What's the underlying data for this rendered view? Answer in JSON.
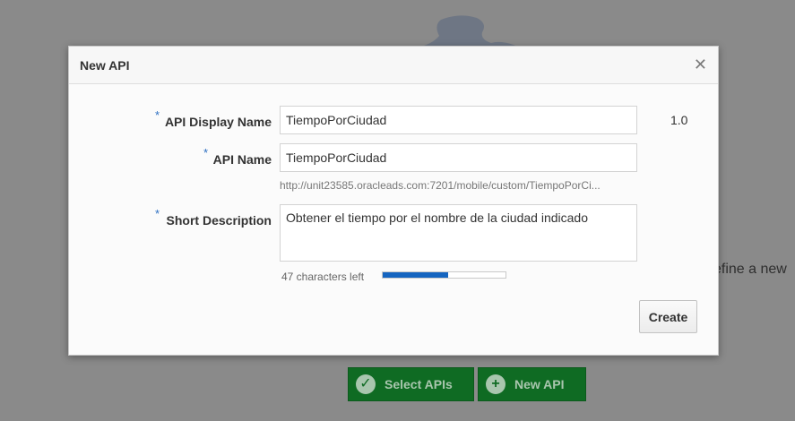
{
  "background": {
    "hint_text": "efine a new",
    "buttons": [
      {
        "label": "Select APIs",
        "icon": "check-circle-icon"
      },
      {
        "label": "New API",
        "icon": "plus-circle-icon"
      }
    ]
  },
  "dialog": {
    "title": "New API",
    "close_icon": "close-icon",
    "required_marker": "*",
    "fields": {
      "display_name": {
        "label": "API Display Name",
        "value": "TiempoPorCiudad"
      },
      "api_name": {
        "label": "API Name",
        "value": "TiempoPorCiudad"
      },
      "short_description": {
        "label": "Short Description",
        "value": "Obtener el tiempo por el nombre de la ciudad indicado"
      }
    },
    "version": "1.0",
    "url": "http://unit23585.oracleads.com:7201/mobile/custom/TiempoPorCi...",
    "chars_left": "47 characters left",
    "char_usage_fraction": 0.53,
    "create_label": "Create"
  },
  "colors": {
    "overlay": "#8a8a8a",
    "accent_blue": "#1565c0",
    "green_button": "#0f6b23"
  }
}
